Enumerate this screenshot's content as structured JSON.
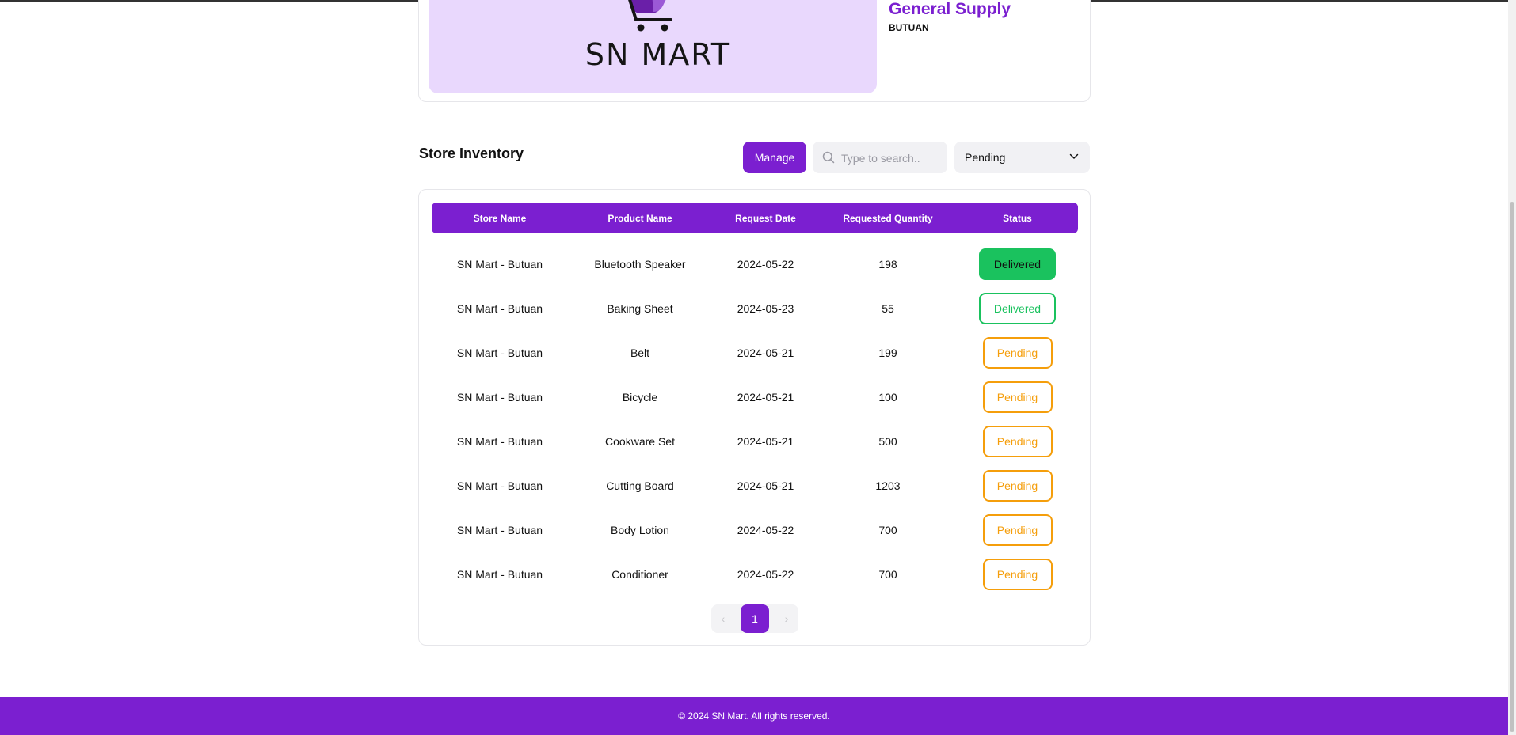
{
  "store": {
    "logo_text": "SN MART",
    "name": "General Supply",
    "location": "BUTUAN"
  },
  "inventory": {
    "title": "Store Inventory",
    "manage_label": "Manage",
    "search_placeholder": "Type to search..",
    "filter_value": "Pending",
    "columns": [
      "Store Name",
      "Product Name",
      "Request Date",
      "Requested Quantity",
      "Status"
    ],
    "rows": [
      {
        "store": "SN Mart - Butuan",
        "product": "Bluetooth Speaker",
        "date": "2024-05-22",
        "qty": "198",
        "status": "Delivered"
      },
      {
        "store": "SN Mart - Butuan",
        "product": "Baking Sheet",
        "date": "2024-05-23",
        "qty": "55",
        "status": "Delivered"
      },
      {
        "store": "SN Mart - Butuan",
        "product": "Belt",
        "date": "2024-05-21",
        "qty": "199",
        "status": "Pending"
      },
      {
        "store": "SN Mart - Butuan",
        "product": "Bicycle",
        "date": "2024-05-21",
        "qty": "100",
        "status": "Pending"
      },
      {
        "store": "SN Mart - Butuan",
        "product": "Cookware Set",
        "date": "2024-05-21",
        "qty": "500",
        "status": "Pending"
      },
      {
        "store": "SN Mart - Butuan",
        "product": "Cutting Board",
        "date": "2024-05-21",
        "qty": "1203",
        "status": "Pending"
      },
      {
        "store": "SN Mart - Butuan",
        "product": "Body Lotion",
        "date": "2024-05-22",
        "qty": "700",
        "status": "Pending"
      },
      {
        "store": "SN Mart - Butuan",
        "product": "Conditioner",
        "date": "2024-05-22",
        "qty": "700",
        "status": "Pending"
      }
    ],
    "pagination": {
      "prev": "‹",
      "current_page": "1",
      "next": "›"
    }
  },
  "footer": {
    "text": "© 2024 SN Mart. All rights reserved."
  },
  "colors": {
    "brand": "#7b1fd0",
    "logo_background": "#e9d8fd",
    "delivered": "#1ac25e",
    "pending": "#f59e0b"
  }
}
